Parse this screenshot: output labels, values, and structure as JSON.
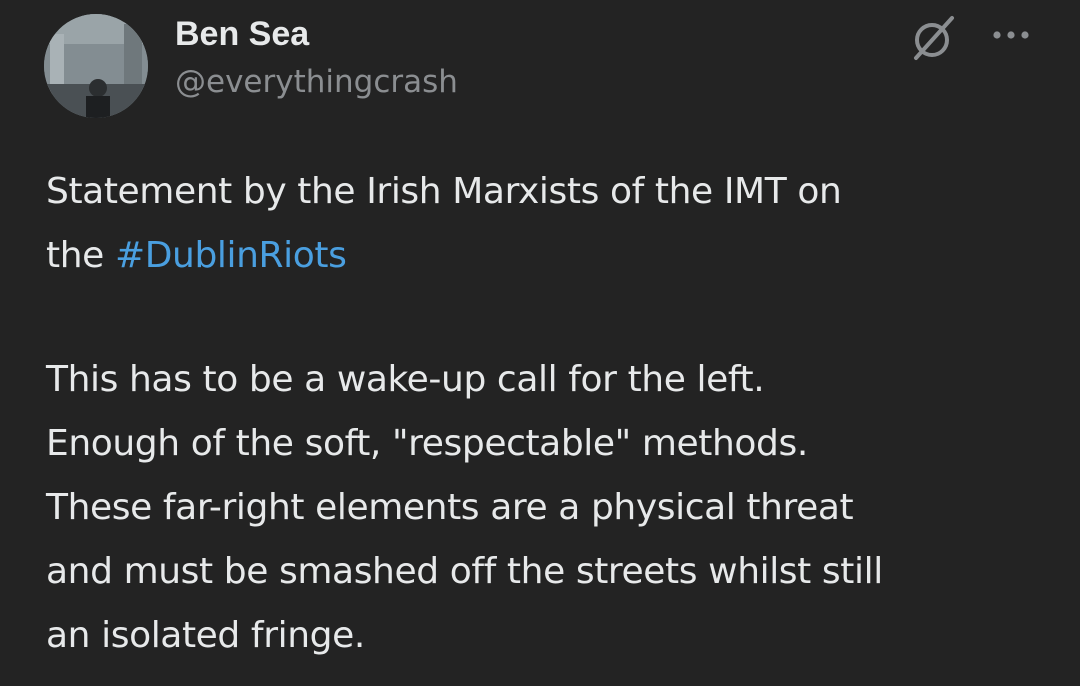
{
  "author": {
    "display_name": "Ben Sea",
    "handle": "@everythingcrash"
  },
  "icons": {
    "grok": "grok-icon",
    "more": "more-options-icon",
    "avatar": "profile-photo"
  },
  "colors": {
    "background": "#232323",
    "text": "#e7e9ea",
    "muted": "#8b8e91",
    "hashtag": "#4a9fe0"
  },
  "post": {
    "intro_prefix": "Statement by the Irish Marxists of the IMT on",
    "intro_the": "the",
    "hashtag": "#DublinRiots",
    "lines": [
      "This has to be a wake-up call for the left.",
      "Enough of the soft, \"respectable\" methods.",
      "These far-right elements are a physical threat",
      "and must be smashed off the streets whilst still",
      "an isolated fringe."
    ]
  }
}
